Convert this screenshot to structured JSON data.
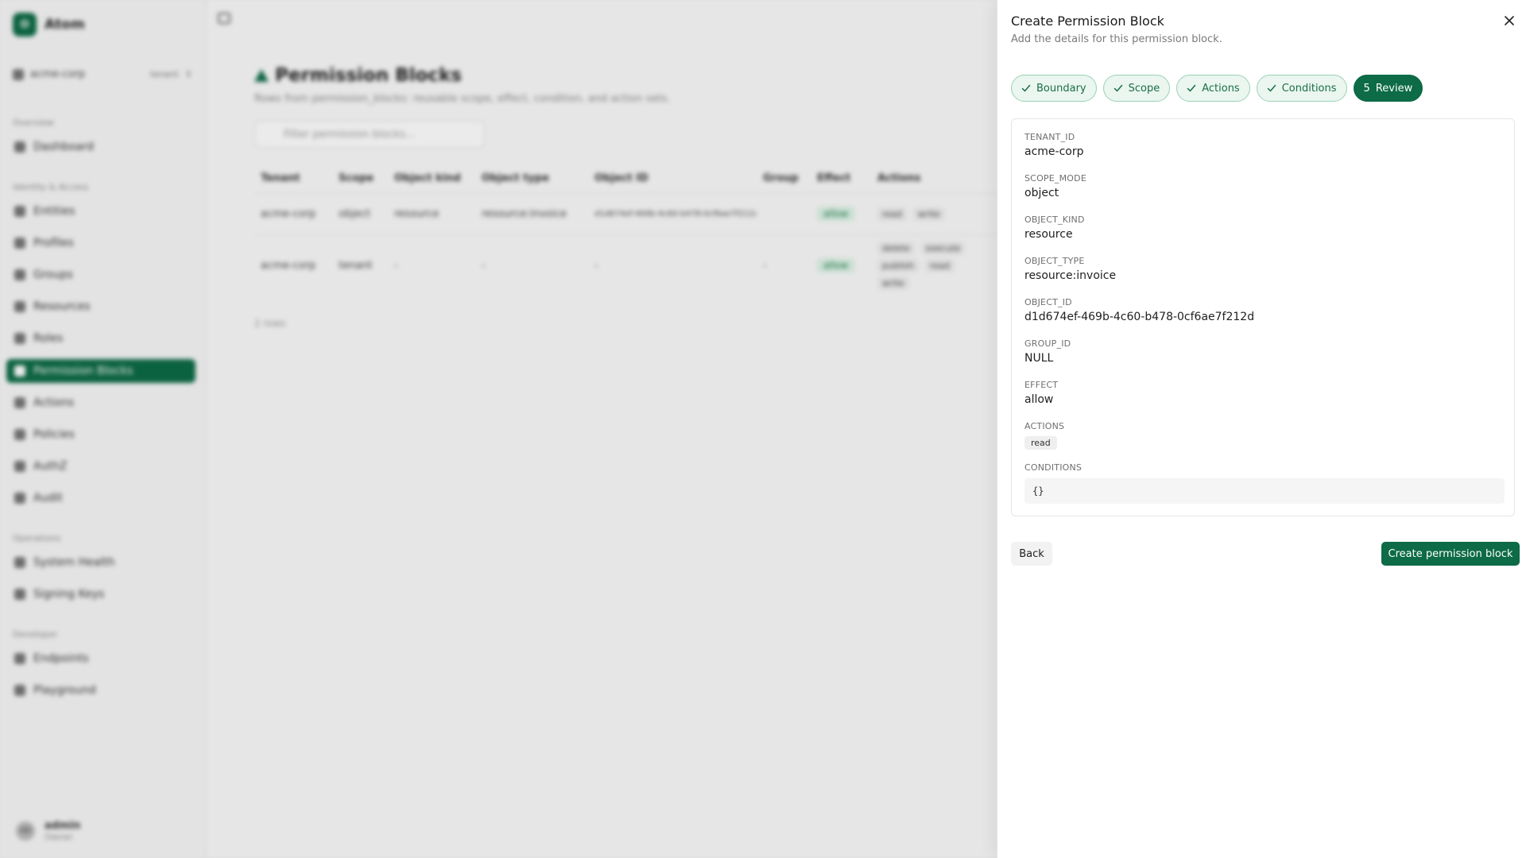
{
  "app": {
    "brand": {
      "logo_letter": "O",
      "name": "Atom"
    },
    "tenant": {
      "name": "acme-corp",
      "badge": "tenant"
    },
    "nav": {
      "sections": [
        "Overview",
        "Identity & Access",
        "Operations",
        "Developer"
      ],
      "items": [
        {
          "label": "Dashboard",
          "icon": "home-icon"
        },
        {
          "label": "Entities",
          "icon": "grid-icon"
        },
        {
          "label": "Profiles",
          "icon": "profile-icon"
        },
        {
          "label": "Groups",
          "icon": "users-icon"
        },
        {
          "label": "Resources",
          "icon": "box-icon"
        },
        {
          "label": "Roles",
          "icon": "shield-icon"
        },
        {
          "label": "Permission Blocks",
          "icon": "triangle-icon",
          "active": true
        },
        {
          "label": "Actions",
          "icon": "pencil-icon"
        },
        {
          "label": "Policies",
          "icon": "policy-icon"
        },
        {
          "label": "AuthZ",
          "icon": "key-icon"
        },
        {
          "label": "Audit",
          "icon": "audit-icon"
        },
        {
          "label": "System Health",
          "icon": "health-icon"
        },
        {
          "label": "Signing Keys",
          "icon": "key-icon"
        },
        {
          "label": "Endpoints",
          "icon": "code-icon"
        },
        {
          "label": "Playground",
          "icon": "code-icon"
        }
      ]
    },
    "user": {
      "initials": "AD",
      "name": "admin",
      "role": "Owner"
    },
    "page": {
      "title": "Permission Blocks",
      "subtitle": "Rows from permission_blocks: reusable scope, effect, condition, and action sets.",
      "filter_placeholder": "Filter permission blocks...",
      "table": {
        "columns": [
          "Tenant",
          "Scope",
          "Object kind",
          "Object type",
          "Object ID",
          "Group",
          "Effect",
          "Actions"
        ],
        "rows": [
          {
            "tenant": "acme-corp",
            "scope": "object",
            "object_kind": "resource",
            "object_type": "resource:invoice",
            "object_id": "d1d674ef-469b-4c60-b478-0cf6ae7f212d",
            "group": "",
            "effect": "allow",
            "actions": [
              "read",
              "write"
            ]
          },
          {
            "tenant": "acme-corp",
            "scope": "tenant",
            "object_kind": "-",
            "object_type": "-",
            "object_id": "-",
            "group": "-",
            "effect": "allow",
            "actions": [
              "delete",
              "execute",
              "publish",
              "read",
              "write"
            ]
          }
        ]
      },
      "items_count": "2 rows"
    }
  },
  "drawer": {
    "title": "Create Permission Block",
    "description": "Add the details for this permission block.",
    "close_icon": "close-icon",
    "steps": [
      {
        "label": "Boundary",
        "status": "done"
      },
      {
        "label": "Scope",
        "status": "done"
      },
      {
        "label": "Actions",
        "status": "done"
      },
      {
        "label": "Conditions",
        "status": "done"
      },
      {
        "label": "Review",
        "status": "current",
        "number": "5"
      }
    ],
    "review": {
      "tenant_id": {
        "label": "TENANT_ID",
        "value": "acme-corp"
      },
      "scope_mode": {
        "label": "SCOPE_MODE",
        "value": "object"
      },
      "object_kind": {
        "label": "OBJECT_KIND",
        "value": "resource"
      },
      "object_type": {
        "label": "OBJECT_TYPE",
        "value": "resource:invoice"
      },
      "object_id": {
        "label": "OBJECT_ID",
        "value": "d1d674ef-469b-4c60-b478-0cf6ae7f212d"
      },
      "group_id": {
        "label": "GROUP_ID",
        "value": "NULL"
      },
      "effect": {
        "label": "EFFECT",
        "value": "allow"
      },
      "actions": {
        "label": "ACTIONS",
        "values": [
          "read"
        ]
      },
      "conditions": {
        "label": "CONDITIONS",
        "value": "{}"
      }
    },
    "back_label": "Back",
    "create_label": "Create permission block"
  },
  "colors": {
    "accent": "#0d6b47",
    "step_done_bg": "#eaf6ef",
    "step_done_border": "#9bd2b4"
  }
}
